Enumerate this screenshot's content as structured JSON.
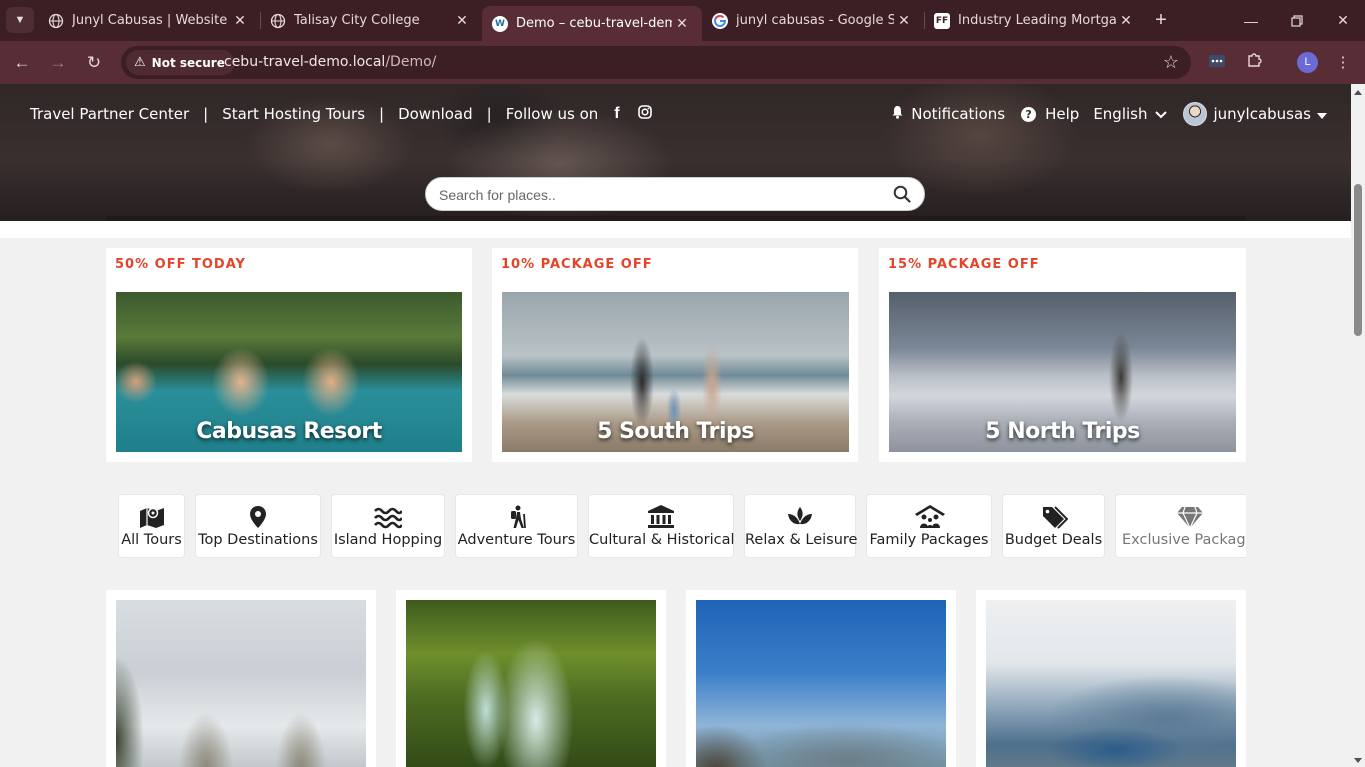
{
  "browser": {
    "tabs": [
      {
        "title": "Junyl Cabusas | Website Dev",
        "favicon": "globe-icon",
        "active": false
      },
      {
        "title": "Talisay City College",
        "favicon": "globe-icon",
        "active": false
      },
      {
        "title": "Demo – cebu-travel-demo",
        "favicon": "wordpress-icon",
        "active": true
      },
      {
        "title": "junyl cabusas - Google Searc",
        "favicon": "google-icon",
        "active": false
      },
      {
        "title": "Industry Leading Mortgage L",
        "favicon": "ff-icon",
        "active": false
      }
    ],
    "security_label": "Not secure",
    "url_host": "cebu-travel-demo.local",
    "url_path": "/Demo/",
    "profile_initial": "L"
  },
  "header": {
    "nav_links": [
      "Travel Partner Center",
      "Start Hosting Tours",
      "Download",
      "Follow us on"
    ],
    "separator": "|",
    "social": {
      "facebook": "f",
      "instagram": "instagram-icon"
    },
    "notifications": "Notifications",
    "help": "Help",
    "help_glyph": "?",
    "language": "English",
    "username": "junylcabusas"
  },
  "search": {
    "placeholder": "Search for places.."
  },
  "promos": [
    {
      "tag": "50% OFF TODAY",
      "caption": "Cabusas Resort"
    },
    {
      "tag": "10% PACKAGE OFF",
      "caption": "5 South Trips"
    },
    {
      "tag": "15% PACKAGE OFF",
      "caption": "5 North Trips"
    }
  ],
  "categories": [
    {
      "label": "All Tours",
      "icon": "map-icon"
    },
    {
      "label": "Top Destinations",
      "icon": "map-pin-icon"
    },
    {
      "label": "Island Hopping",
      "icon": "water-icon"
    },
    {
      "label": "Adventure Tours",
      "icon": "hiker-icon"
    },
    {
      "label": "Cultural & Historical",
      "icon": "landmark-icon"
    },
    {
      "label": "Relax & Leisure",
      "icon": "spa-icon"
    },
    {
      "label": "Family Packages",
      "icon": "family-icon"
    },
    {
      "label": "Budget Deals",
      "icon": "tags-icon"
    },
    {
      "label": "Exclusive Packages",
      "icon": "gem-icon"
    }
  ],
  "destinations": [
    {
      "image": "rock-formations"
    },
    {
      "image": "waterfall"
    },
    {
      "image": "mountain-hiker"
    },
    {
      "image": "fjord-view"
    }
  ],
  "colors": {
    "promo_tag": "#e3442a",
    "tab_bar": "#3b1f24",
    "toolbar": "#582d35"
  }
}
